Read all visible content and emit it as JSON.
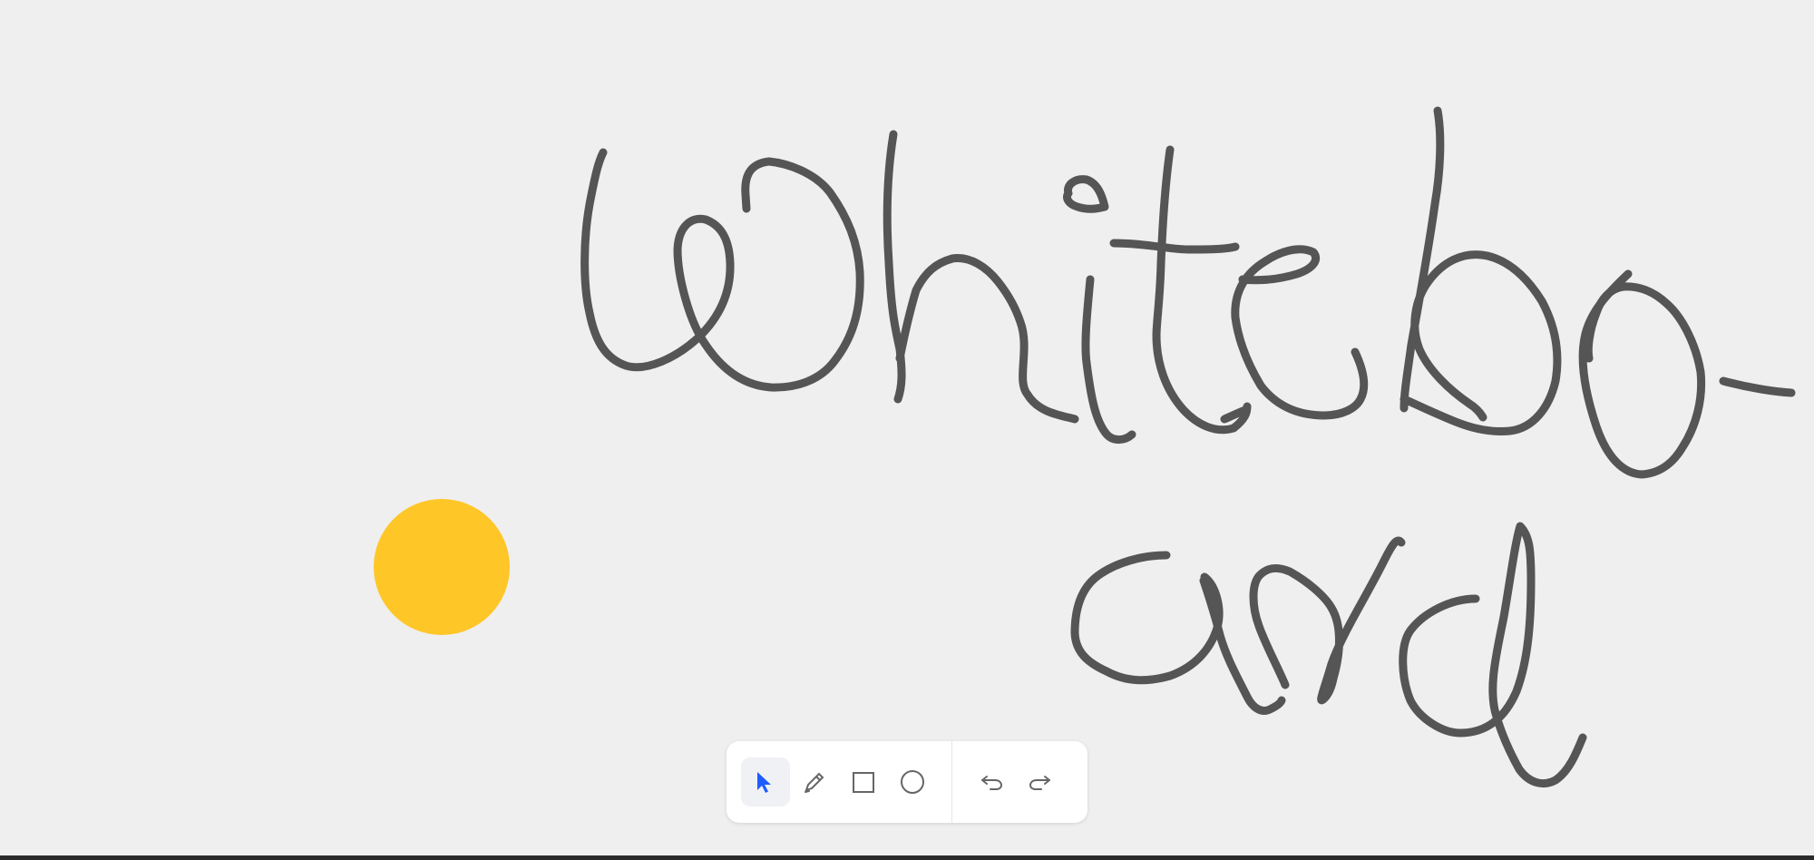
{
  "app": {
    "canvas_background": "#efefef",
    "ink_color": "#555555",
    "shape_fill_color": "#ffc628"
  },
  "canvas": {
    "handwriting_lines": [
      "Whitebo-",
      "ard"
    ],
    "shapes": [
      {
        "type": "circle",
        "color": "#ffc628"
      }
    ]
  },
  "toolbar": {
    "accent_color": "#1f5cff",
    "tools": [
      {
        "icon": "select-arrow-icon",
        "active": true
      },
      {
        "icon": "pencil-icon",
        "active": false
      },
      {
        "icon": "rectangle-icon",
        "active": false
      },
      {
        "icon": "circle-icon",
        "active": false
      }
    ],
    "history": [
      {
        "icon": "undo-icon"
      },
      {
        "icon": "redo-icon"
      }
    ]
  }
}
